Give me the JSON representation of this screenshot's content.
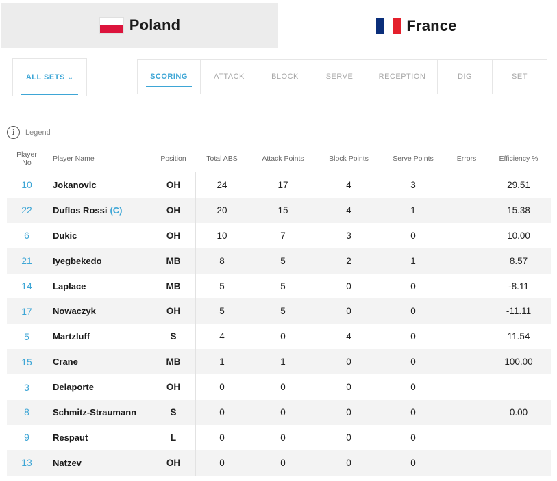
{
  "teams": [
    {
      "name": "Poland",
      "flag": "poland-flag",
      "active": false
    },
    {
      "name": "France",
      "flag": "france-flag",
      "active": true
    }
  ],
  "filter": {
    "sets_label": "ALL SETS"
  },
  "categories": [
    "SCORING",
    "ATTACK",
    "BLOCK",
    "SERVE",
    "RECEPTION",
    "DIG",
    "SET"
  ],
  "active_category": "SCORING",
  "legend_label": "Legend",
  "columns": {
    "no_line1": "Player",
    "no_line2": "No",
    "name": "Player Name",
    "position": "Position",
    "total": "Total ABS",
    "attack": "Attack Points",
    "block": "Block Points",
    "serve": "Serve Points",
    "errors": "Errors",
    "efficiency": "Efficiency %"
  },
  "players": [
    {
      "no": "10",
      "name": "Jokanovic",
      "captain": "",
      "pos": "OH",
      "total": "24",
      "attack": "17",
      "block": "4",
      "serve": "3",
      "errors": "",
      "eff": "29.51"
    },
    {
      "no": "22",
      "name": "Duflos Rossi",
      "captain": "(C)",
      "pos": "OH",
      "total": "20",
      "attack": "15",
      "block": "4",
      "serve": "1",
      "errors": "",
      "eff": "15.38"
    },
    {
      "no": "6",
      "name": "Dukic",
      "captain": "",
      "pos": "OH",
      "total": "10",
      "attack": "7",
      "block": "3",
      "serve": "0",
      "errors": "",
      "eff": "10.00"
    },
    {
      "no": "21",
      "name": "Iyegbekedo",
      "captain": "",
      "pos": "MB",
      "total": "8",
      "attack": "5",
      "block": "2",
      "serve": "1",
      "errors": "",
      "eff": "8.57"
    },
    {
      "no": "14",
      "name": "Laplace",
      "captain": "",
      "pos": "MB",
      "total": "5",
      "attack": "5",
      "block": "0",
      "serve": "0",
      "errors": "",
      "eff": "-8.11"
    },
    {
      "no": "17",
      "name": "Nowaczyk",
      "captain": "",
      "pos": "OH",
      "total": "5",
      "attack": "5",
      "block": "0",
      "serve": "0",
      "errors": "",
      "eff": "-11.11"
    },
    {
      "no": "5",
      "name": "Martzluff",
      "captain": "",
      "pos": "S",
      "total": "4",
      "attack": "0",
      "block": "4",
      "serve": "0",
      "errors": "",
      "eff": "11.54"
    },
    {
      "no": "15",
      "name": "Crane",
      "captain": "",
      "pos": "MB",
      "total": "1",
      "attack": "1",
      "block": "0",
      "serve": "0",
      "errors": "",
      "eff": "100.00"
    },
    {
      "no": "3",
      "name": "Delaporte",
      "captain": "",
      "pos": "OH",
      "total": "0",
      "attack": "0",
      "block": "0",
      "serve": "0",
      "errors": "",
      "eff": ""
    },
    {
      "no": "8",
      "name": "Schmitz-Straumann",
      "captain": "",
      "pos": "S",
      "total": "0",
      "attack": "0",
      "block": "0",
      "serve": "0",
      "errors": "",
      "eff": "0.00"
    },
    {
      "no": "9",
      "name": "Respaut",
      "captain": "",
      "pos": "L",
      "total": "0",
      "attack": "0",
      "block": "0",
      "serve": "0",
      "errors": "",
      "eff": ""
    },
    {
      "no": "13",
      "name": "Natzev",
      "captain": "",
      "pos": "OH",
      "total": "0",
      "attack": "0",
      "block": "0",
      "serve": "0",
      "errors": "",
      "eff": ""
    }
  ],
  "colors": {
    "accent": "#3ea6d6",
    "inactive_tab_bg": "#ececec",
    "stripe": "#f3f3f3"
  }
}
